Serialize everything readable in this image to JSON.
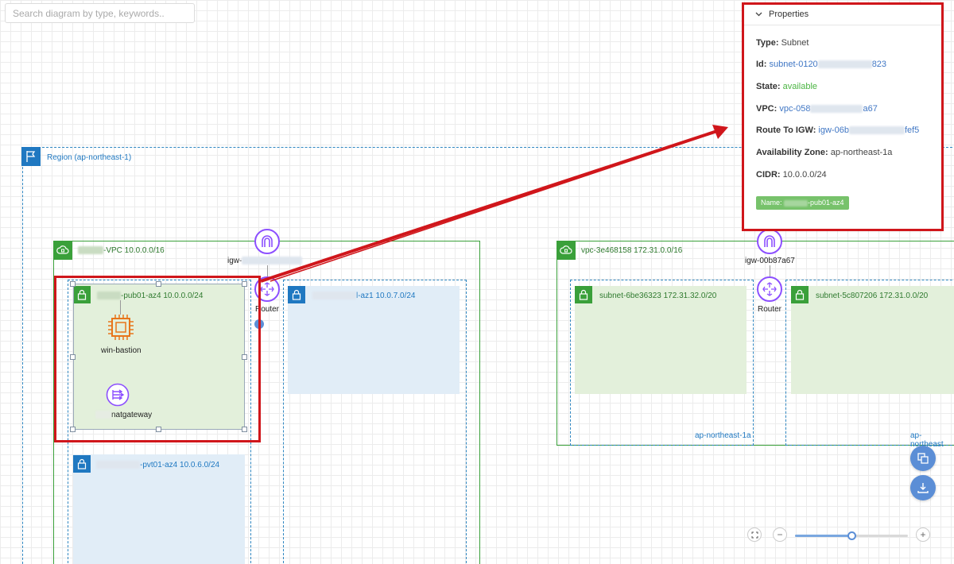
{
  "search": {
    "placeholder": "Search diagram by type, keywords.."
  },
  "region": {
    "label": "Region (ap-northeast-1)"
  },
  "vpc1": {
    "label": "-VPC 10.0.0.0/16",
    "igw_label": "igw-",
    "router_label": "Router",
    "subnets": {
      "pub01": {
        "label": "-pub01-az4 10.0.0.0/24"
      },
      "az1": {
        "label": "l-az1 10.0.7.0/24"
      },
      "pvt01": {
        "label": "-pvt01-az4 10.0.6.0/24"
      }
    },
    "nodes": {
      "bastion": "win-bastion",
      "nat": "natgateway"
    }
  },
  "vpc2": {
    "label": "vpc-3e468158 172.31.0.0/16",
    "igw_label": "igw-00b87a67",
    "router_label": "Router",
    "subnet_a": {
      "label": "subnet-6be36323 172.31.32.0/20",
      "az": "ap-northeast-1a"
    },
    "subnet_b": {
      "label": "subnet-5c807206 172.31.0.0/20",
      "az": "ap-northeast"
    }
  },
  "properties": {
    "title": "Properties",
    "type_key": "Type:",
    "type_val": "Subnet",
    "id_key": "Id:",
    "id_pre": "subnet-0120",
    "id_post": "823",
    "state_key": "State:",
    "state_val": "available",
    "vpc_key": "VPC:",
    "vpc_pre": "vpc-058",
    "vpc_post": "a67",
    "igw_key": "Route To IGW:",
    "igw_pre": "igw-06b",
    "igw_post": "fef5",
    "az_key": "Availability Zone:",
    "az_val": "ap-northeast-1a",
    "cidr_key": "CIDR:",
    "cidr_val": "10.0.0.0/24",
    "name_pre": "Name:",
    "name_post": "-pub01-az4"
  },
  "zoom": {
    "minus": "−",
    "plus": "+",
    "level": 0.5
  },
  "colors": {
    "vpc": "#3aa03a",
    "region": "#1f78c1",
    "highlight": "#d0161b",
    "gateway": "#8c4fff"
  }
}
